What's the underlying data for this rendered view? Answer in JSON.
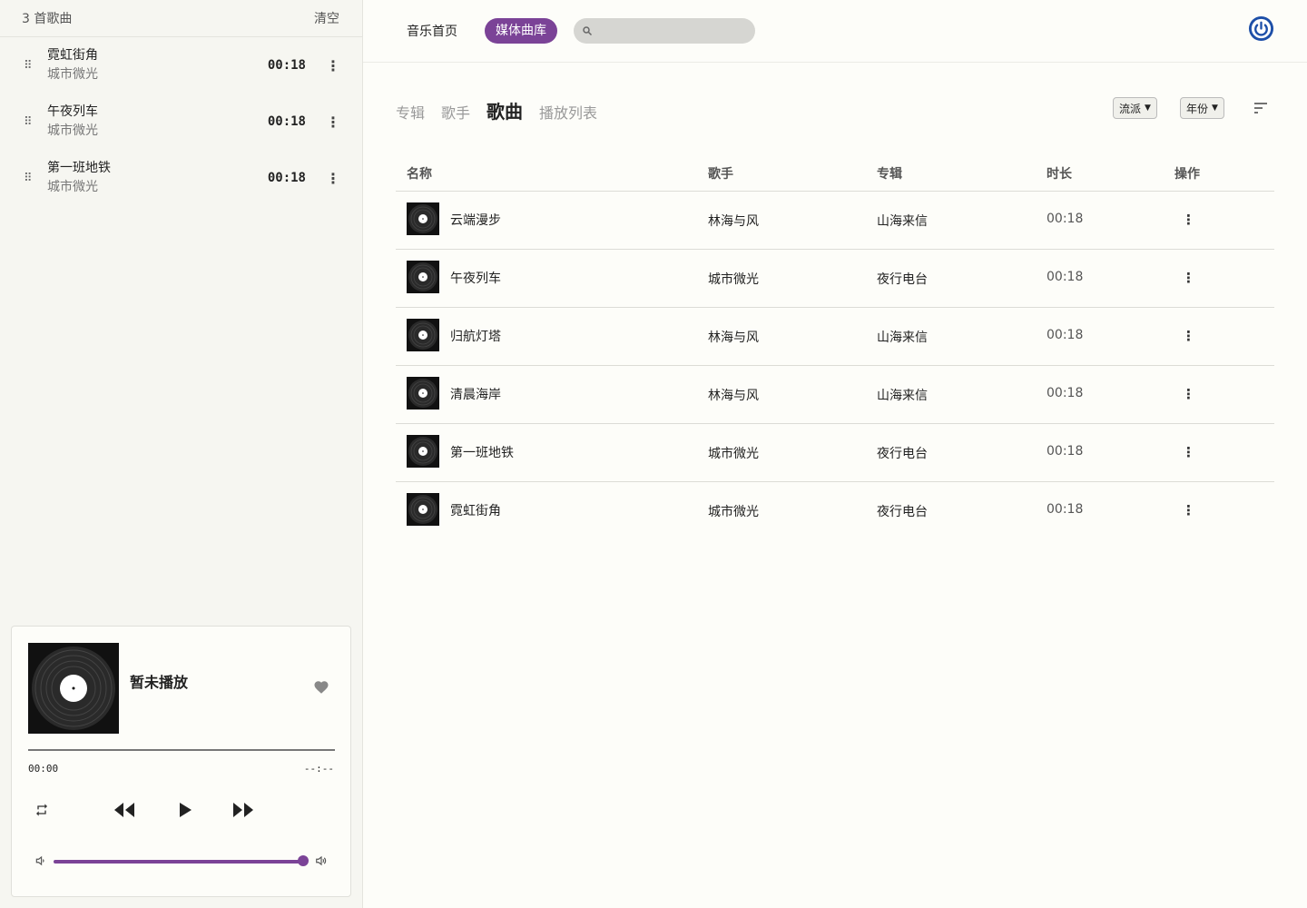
{
  "queue": {
    "count_label": "3 首歌曲",
    "clear_label": "清空",
    "items": [
      {
        "title": "霓虹街角",
        "artist": "城市微光",
        "duration": "00:18"
      },
      {
        "title": "午夜列车",
        "artist": "城市微光",
        "duration": "00:18"
      },
      {
        "title": "第一班地铁",
        "artist": "城市微光",
        "duration": "00:18"
      }
    ]
  },
  "player": {
    "title": "暂未播放",
    "current_time": "00:00",
    "total_time": "--:--",
    "progress": 0,
    "volume": 1.0,
    "accent_color": "#7b4397"
  },
  "topbar": {
    "home_label": "音乐首页",
    "library_label": "媒体曲库",
    "search_placeholder": ""
  },
  "tabs": [
    {
      "label": "专辑",
      "active": false
    },
    {
      "label": "歌手",
      "active": false
    },
    {
      "label": "歌曲",
      "active": true
    },
    {
      "label": "播放列表",
      "active": false
    }
  ],
  "filters": {
    "genre_label": "流派",
    "year_label": "年份"
  },
  "table": {
    "headers": {
      "name": "名称",
      "artist": "歌手",
      "album": "专辑",
      "duration": "时长",
      "actions": "操作"
    },
    "rows": [
      {
        "name": "云端漫步",
        "artist": "林海与风",
        "album": "山海来信",
        "duration": "00:18"
      },
      {
        "name": "午夜列车",
        "artist": "城市微光",
        "album": "夜行电台",
        "duration": "00:18"
      },
      {
        "name": "归航灯塔",
        "artist": "林海与风",
        "album": "山海来信",
        "duration": "00:18"
      },
      {
        "name": "清晨海岸",
        "artist": "林海与风",
        "album": "山海来信",
        "duration": "00:18"
      },
      {
        "name": "第一班地铁",
        "artist": "城市微光",
        "album": "夜行电台",
        "duration": "00:18"
      },
      {
        "name": "霓虹街角",
        "artist": "城市微光",
        "album": "夜行电台",
        "duration": "00:18"
      }
    ]
  }
}
